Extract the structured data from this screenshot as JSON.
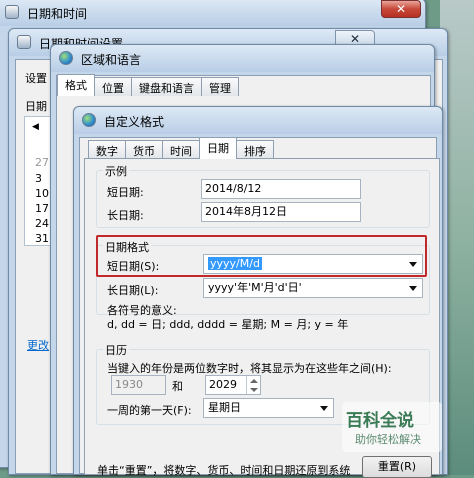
{
  "win1": {
    "title": "日期和时间"
  },
  "win2": {
    "title": "日期和时间设置",
    "settings_label": "设置",
    "date_label": "日期",
    "nav_left": "◀",
    "cal_rows": [
      "27",
      "3",
      "10",
      "17",
      "24",
      "31"
    ],
    "link_text": "更改"
  },
  "win3": {
    "title": "区域和语言",
    "tabs": [
      "格式",
      "位置",
      "键盘和语言",
      "管理"
    ]
  },
  "win4": {
    "title": "自定义格式",
    "tabs": [
      "数字",
      "货币",
      "时间",
      "日期",
      "排序"
    ],
    "example": {
      "group": "示例",
      "short_label": "短日期:",
      "short_value": "2014/8/12",
      "long_label": "长日期:",
      "long_value": "2014年8月12日"
    },
    "format": {
      "group": "日期格式",
      "short_label": "短日期(S):",
      "short_value": "yyyy/M/d",
      "long_label": "长日期(L):",
      "long_value": "yyyy'年'M'月'd'日'"
    },
    "symbols": {
      "heading": "各符号的意义:",
      "text": "d, dd = 日;  ddd, dddd = 星期;  M = 月;  y = 年"
    },
    "calendar": {
      "group": "日历",
      "twodigit_text": "当键入的年份是两位数字时，将其显示为在这些年之间(H):",
      "from_year": "1930",
      "and": "和",
      "to_year": "2029",
      "firstday_label": "一周的第一天(F):",
      "firstday_value": "星期日"
    },
    "bottom_text": "单击“重置”，将数字、货币、时间和日期还原到系统",
    "reset_label": "重置(R)"
  },
  "watermark": {
    "title": "百科全说",
    "subtitle": "助你轻松解决"
  },
  "close_glyph": "✕"
}
